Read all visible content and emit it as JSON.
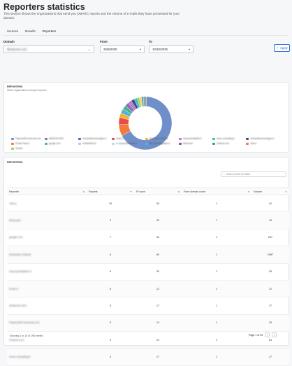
{
  "header": {
    "title": "Reporters statistics",
    "subtitle": "This section shows the organizations that send you DMARC reports and the volume of e-mails they have processed for your domain."
  },
  "tabs": [
    {
      "label": "Sources"
    },
    {
      "label": "Results"
    },
    {
      "label": "Reporters"
    }
  ],
  "filters": {
    "domain_label": "Domain",
    "domain_value": "fibralsoria.com",
    "from_label": "From",
    "from_value": "26/9/2025",
    "to_label": "To",
    "to_value": "10/10/2025",
    "apply_label": "Apply"
  },
  "chart_card": {
    "title": "REPORTERS",
    "subtitle": "Which organizations send you reports?"
  },
  "chart_data": {
    "type": "pie",
    "donut": true,
    "title": "REPORTERS",
    "subtitle": "Which organizations send you reports?",
    "slices": [
      {
        "label": "Yahoo",
        "value": 19,
        "color": "#6f8fc9"
      },
      {
        "label": "Mimecast",
        "value": 2,
        "color": "#f47a3c"
      },
      {
        "label": "google.com",
        "value": 1.2,
        "color": "#e94a4a"
      },
      {
        "label": "Enterprise Outlook",
        "value": 0.8,
        "color": "#f0b429"
      },
      {
        "label": "www.psmdatabin.it",
        "value": 0.8,
        "color": "#53b0e6"
      },
      {
        "label": "Kodio.it",
        "value": 0.7,
        "color": "#4cb67d"
      },
      {
        "label": "AMAZON SES",
        "value": 0.7,
        "color": "#8e6cc9"
      },
      {
        "label": "fiapersaif.voxcentral.com",
        "value": 0.6,
        "color": "#c973c3"
      },
      {
        "label": "Outlook.com",
        "value": 0.6,
        "color": "#3a4e8f"
      },
      {
        "label": "soum consulting.it",
        "value": 0.5,
        "color": "#36c1b2"
      },
      {
        "label": "google.com.au",
        "value": 0.4,
        "color": "#9ccc65"
      },
      {
        "label": "verispatent.it",
        "value": 0.4,
        "color": "#ffcc80"
      },
      {
        "label": "cbroker.org",
        "value": 0.3,
        "color": "#26a69a"
      },
      {
        "label": "Other",
        "value": 0.6,
        "color": "#90a4ae"
      }
    ]
  },
  "legend": [
    {
      "label": "FiapersaifCrovaronat.com",
      "color": "#6f8fc9"
    },
    {
      "label": "AMAZON SES",
      "color": "#8e6cc9"
    },
    {
      "label": "verbandtravenanaigue.it",
      "color": "#2f6fd0"
    },
    {
      "label": "Kodio.it",
      "color": "#e94a4a"
    },
    {
      "label": "Enterprise Outlook",
      "color": "#f0b429"
    },
    {
      "label": "www.psmdatabin.it",
      "color": "#c973c3"
    },
    {
      "label": "soum consulting.it",
      "color": "#36c1b2"
    },
    {
      "label": "verbandtravenanaigue.it",
      "color": "#3a4e8f"
    },
    {
      "label": "Emailc Pase.it",
      "color": "#f47a3c"
    },
    {
      "label": "google.com",
      "color": "#4cb67d"
    },
    {
      "label": "fontibalbutic.it",
      "color": "#c8c8c8"
    },
    {
      "label": "ru.respondistributor.it",
      "color": "#b5dcee"
    },
    {
      "label": "fibroshintadigitalpe.it",
      "color": "#53b0e6"
    },
    {
      "label": "Mimecast",
      "color": "#6d54b5"
    },
    {
      "label": "Outlook.com",
      "color": "#26a69a"
    },
    {
      "label": "Yahoo",
      "color": "#ff6f61"
    },
    {
      "label": "cbroker",
      "color": "#9ccc65"
    }
  ],
  "table_card": {
    "title": "REPORTERS",
    "search_placeholder": "Search inside the table",
    "columns": [
      "Reporter",
      "Reports",
      "IP count",
      "From domain count",
      "Volume"
    ],
    "rows": [
      {
        "reporter": "Yahoo",
        "reports": "19",
        "ip": "34",
        "from": "1",
        "volume": "41"
      },
      {
        "reporter": "Mimecast",
        "reports": "9",
        "ip": "32",
        "from": "1",
        "volume": "15"
      },
      {
        "reporter": "google.com",
        "reports": "7",
        "ip": "44",
        "from": "1",
        "volume": "247"
      },
      {
        "reporter": "Enterprise Outlook",
        "reports": "6",
        "ip": "60",
        "from": "1",
        "volume": "2087"
      },
      {
        "reporter": "www.psmdatabin.it",
        "reports": "6",
        "ip": "32",
        "from": "1",
        "volume": "33"
      },
      {
        "reporter": "Kodio.it",
        "reports": "6",
        "ip": "12",
        "from": "1",
        "volume": "12"
      },
      {
        "reporter": "AMAZON SES",
        "reports": "5",
        "ip": "17",
        "from": "1",
        "volume": "17"
      },
      {
        "reporter": "FiapersaifCrovaronat.com",
        "reports": "5",
        "ip": "10",
        "from": "1",
        "volume": "16"
      },
      {
        "reporter": "Outlook.com",
        "reports": "4",
        "ip": "22",
        "from": "1",
        "volume": "24"
      },
      {
        "reporter": "soum consulting.it",
        "reports": "4",
        "ip": "17",
        "from": "1",
        "volume": "17"
      }
    ],
    "footer_text": "Showing 1 to 10 of 195 entries",
    "page_text": "Page 1 of 20",
    "prev_label": "‹",
    "next_label": "›"
  }
}
